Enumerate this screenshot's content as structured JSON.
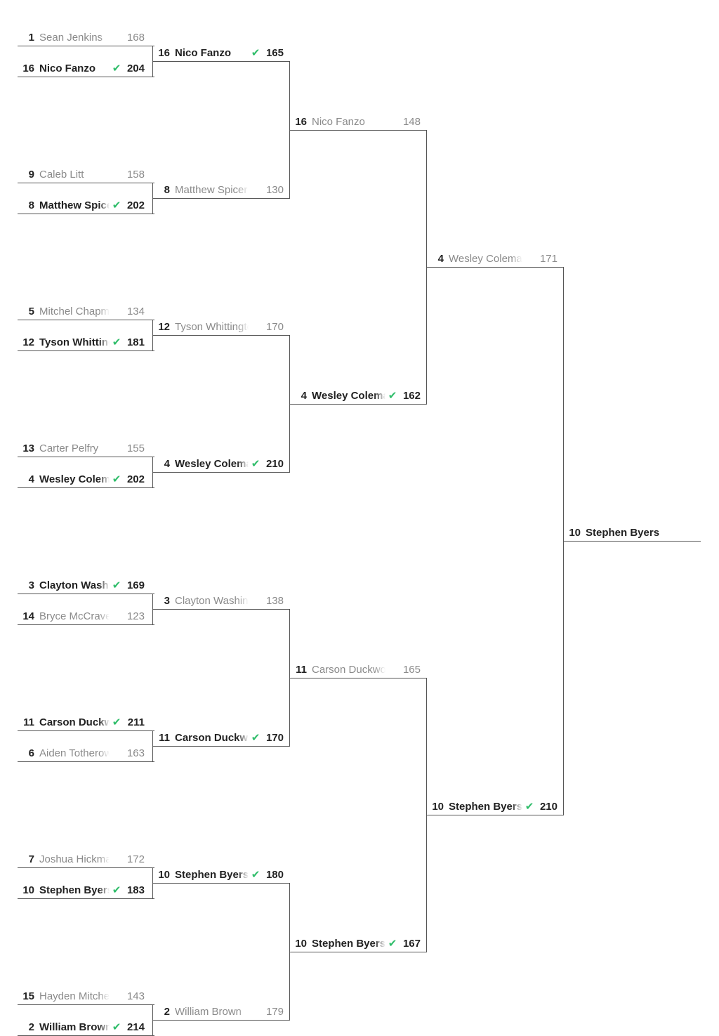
{
  "colors": {
    "winner_check": "#2fbd6a",
    "winner_text": "#222222",
    "loser_text": "#8a8a8a",
    "line": "#555555"
  },
  "rounds": [
    {
      "name": "round-1",
      "matches": [
        {
          "slots": [
            {
              "seed": "1",
              "name": "Sean Jenkins",
              "score": "168",
              "winner": false
            },
            {
              "seed": "16",
              "name": "Nico Fanzo",
              "score": "204",
              "winner": true
            }
          ]
        },
        {
          "slots": [
            {
              "seed": "9",
              "name": "Caleb Litt",
              "score": "158",
              "winner": false
            },
            {
              "seed": "8",
              "name": "Matthew Spicer",
              "score": "202",
              "winner": true
            }
          ]
        },
        {
          "slots": [
            {
              "seed": "5",
              "name": "Mitchel Chapman",
              "score": "134",
              "winner": false
            },
            {
              "seed": "12",
              "name": "Tyson Whittington",
              "score": "181",
              "winner": true
            }
          ]
        },
        {
          "slots": [
            {
              "seed": "13",
              "name": "Carter Pelfry",
              "score": "155",
              "winner": false
            },
            {
              "seed": "4",
              "name": "Wesley Coleman",
              "score": "202",
              "winner": true
            }
          ]
        },
        {
          "slots": [
            {
              "seed": "3",
              "name": "Clayton Washington",
              "score": "169",
              "winner": true
            },
            {
              "seed": "14",
              "name": "Bryce McCraven",
              "score": "123",
              "winner": false
            }
          ]
        },
        {
          "slots": [
            {
              "seed": "11",
              "name": "Carson Duckworth",
              "score": "211",
              "winner": true
            },
            {
              "seed": "6",
              "name": "Aiden Totherow",
              "score": "163",
              "winner": false
            }
          ]
        },
        {
          "slots": [
            {
              "seed": "7",
              "name": "Joshua Hickman",
              "score": "172",
              "winner": false
            },
            {
              "seed": "10",
              "name": "Stephen Byers",
              "score": "183",
              "winner": true
            }
          ]
        },
        {
          "slots": [
            {
              "seed": "15",
              "name": "Hayden Mitchell",
              "score": "143",
              "winner": false
            },
            {
              "seed": "2",
              "name": "William Brown",
              "score": "214",
              "winner": true
            }
          ]
        }
      ]
    },
    {
      "name": "round-2",
      "matches": [
        {
          "slots": [
            {
              "seed": "16",
              "name": "Nico Fanzo",
              "score": "165",
              "winner": true
            },
            {
              "seed": "8",
              "name": "Matthew Spicer",
              "score": "130",
              "winner": false
            }
          ]
        },
        {
          "slots": [
            {
              "seed": "12",
              "name": "Tyson Whittington",
              "score": "170",
              "winner": false
            },
            {
              "seed": "4",
              "name": "Wesley Coleman",
              "score": "210",
              "winner": true
            }
          ]
        },
        {
          "slots": [
            {
              "seed": "3",
              "name": "Clayton Washington",
              "score": "138",
              "winner": false
            },
            {
              "seed": "11",
              "name": "Carson Duckworth",
              "score": "170",
              "winner": true
            }
          ]
        },
        {
          "slots": [
            {
              "seed": "10",
              "name": "Stephen Byers",
              "score": "180",
              "winner": true
            },
            {
              "seed": "2",
              "name": "William Brown",
              "score": "179",
              "winner": false
            }
          ]
        }
      ]
    },
    {
      "name": "round-3",
      "matches": [
        {
          "slots": [
            {
              "seed": "16",
              "name": "Nico Fanzo",
              "score": "148",
              "winner": false
            },
            {
              "seed": "4",
              "name": "Wesley Coleman",
              "score": "162",
              "winner": true
            }
          ]
        },
        {
          "slots": [
            {
              "seed": "11",
              "name": "Carson Duckworth",
              "score": "165",
              "winner": false
            },
            {
              "seed": "10",
              "name": "Stephen Byers",
              "score": "167",
              "winner": true
            }
          ]
        }
      ]
    },
    {
      "name": "round-4",
      "matches": [
        {
          "slots": [
            {
              "seed": "4",
              "name": "Wesley Coleman",
              "score": "171",
              "winner": false
            },
            {
              "seed": "10",
              "name": "Stephen Byers",
              "score": "210",
              "winner": true
            }
          ]
        }
      ]
    }
  ],
  "champion": {
    "seed": "10",
    "name": "Stephen Byers"
  }
}
